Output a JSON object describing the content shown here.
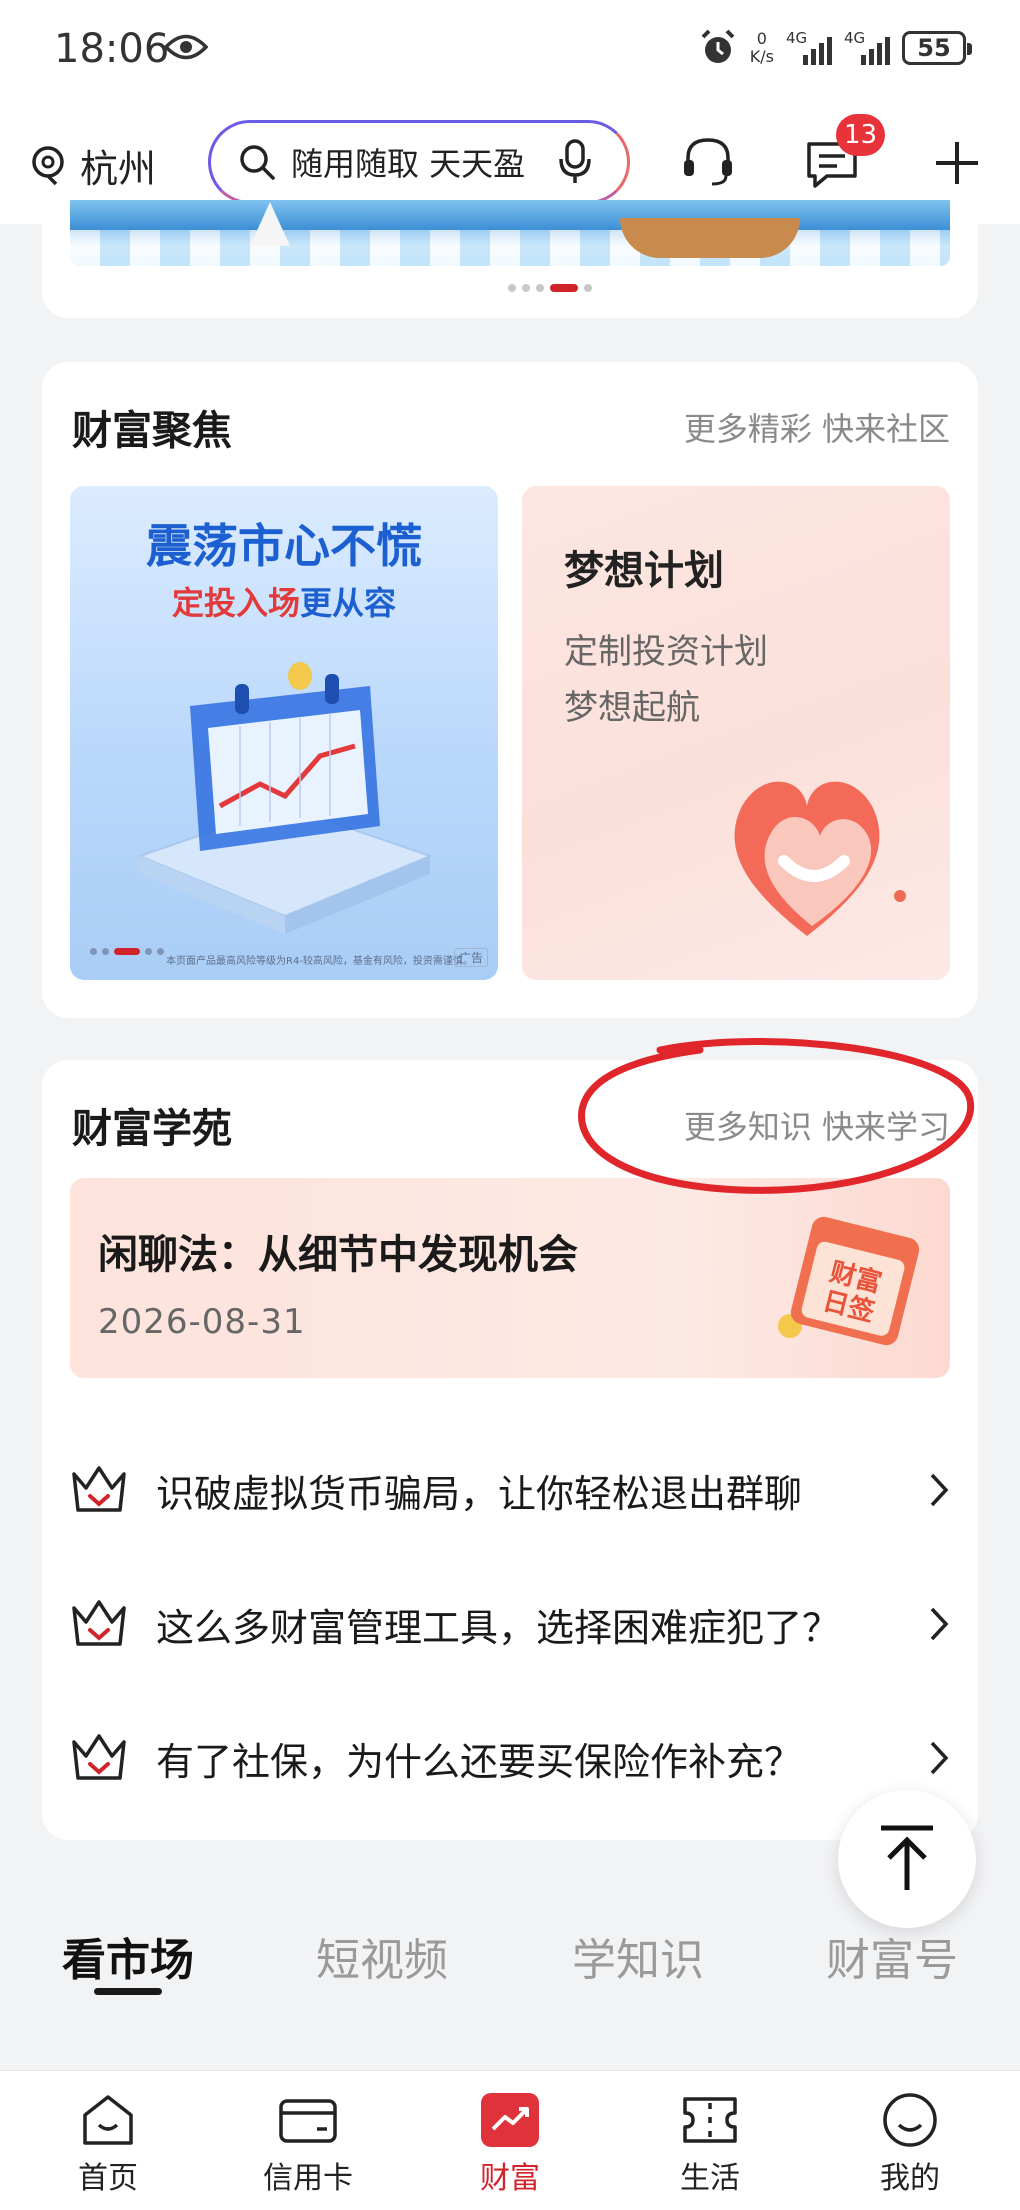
{
  "status_bar": {
    "time": "18:06",
    "net_speed_top": "0",
    "net_speed_unit": "K/s",
    "signal1_label": "4G",
    "signal2_label": "4G",
    "battery": "55"
  },
  "top_nav": {
    "city": "杭州",
    "search_placeholder": "随用随取 天天盈",
    "message_badge": "13"
  },
  "wealth_focus": {
    "title": "财富聚焦",
    "more": "更多精彩 快来社区",
    "promo_left": {
      "headline": "震荡市心不慌",
      "sub_red": "定投入场",
      "sub_blue": "更从容",
      "disclaimer": "本页面产品最高风险等级为R4-较高风险，基金有风险，投资需谨慎。",
      "ad_tag": "广告"
    },
    "promo_right": {
      "title": "梦想计划",
      "line1": "定制投资计划",
      "line2": "梦想起航"
    }
  },
  "wealth_academy": {
    "title": "财富学苑",
    "more": "更多知识 快来学习",
    "feature": {
      "title": "闲聊法：从细节中发现机会",
      "date": "2026-08-31",
      "art_text": "财富日签"
    },
    "articles": [
      {
        "title": "识破虚拟货币骗局，让你轻松退出群聊"
      },
      {
        "title": "这么多财富管理工具，选择困难症犯了？"
      },
      {
        "title": "有了社保，为什么还要买保险作补充？"
      }
    ]
  },
  "content_tabs": [
    "看市场",
    "短视频",
    "学知识",
    "财富号"
  ],
  "bottom_nav": [
    {
      "label": "首页",
      "icon": "home-icon"
    },
    {
      "label": "信用卡",
      "icon": "credit-card-icon"
    },
    {
      "label": "财富",
      "icon": "wealth-icon"
    },
    {
      "label": "生活",
      "icon": "ticket-icon"
    },
    {
      "label": "我的",
      "icon": "profile-icon"
    }
  ],
  "colors": {
    "accent_red": "#d1232a",
    "badge_red": "#e8333a",
    "promo_blue": "#1b5fd1"
  }
}
